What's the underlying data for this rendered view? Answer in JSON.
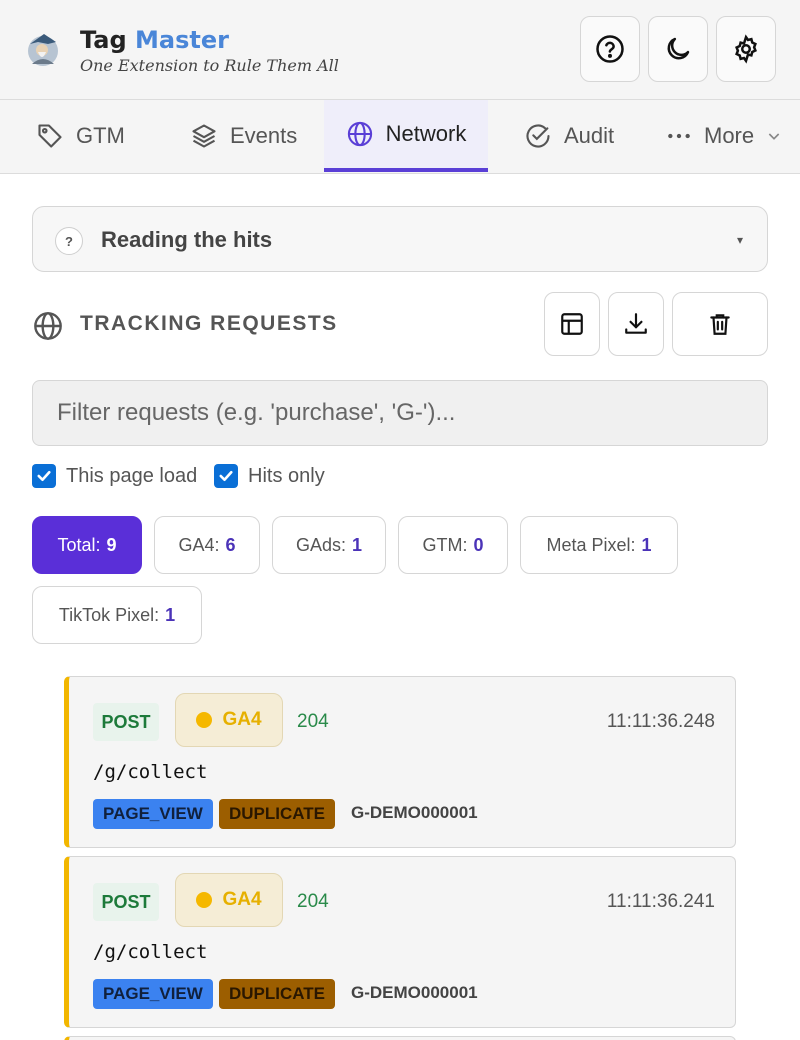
{
  "header": {
    "title_part1": "Tag",
    "title_part2": "Master",
    "subtitle": "One Extension to Rule Them All",
    "buttons": [
      "help-icon",
      "moon-icon",
      "gear-icon"
    ]
  },
  "tabs": [
    {
      "label": "GTM",
      "icon": "tag-icon"
    },
    {
      "label": "Events",
      "icon": "layers-icon"
    },
    {
      "label": "Network",
      "icon": "globe-icon",
      "active": true
    },
    {
      "label": "Audit",
      "icon": "check-circle-icon"
    },
    {
      "label": "More",
      "icon": "more-icon"
    }
  ],
  "reading": {
    "icon_text": "?",
    "label": "Reading the hits",
    "caret": "▾"
  },
  "section": {
    "title": "TRACKING REQUESTS"
  },
  "filter": {
    "placeholder": "Filter requests (e.g. 'purchase', 'G-')..."
  },
  "checkboxes": [
    {
      "label": "This page load",
      "checked": true
    },
    {
      "label": "Hits only",
      "checked": true
    }
  ],
  "chips": [
    {
      "label": "Total:",
      "count": "9",
      "active": true
    },
    {
      "label": "GA4:",
      "count": "6"
    },
    {
      "label": "GAds:",
      "count": "1"
    },
    {
      "label": "GTM:",
      "count": "0"
    },
    {
      "label": "Meta Pixel:",
      "count": "1"
    },
    {
      "label": "TikTok Pixel:",
      "count": "1"
    }
  ],
  "requests": [
    {
      "method": "POST",
      "vendor": "GA4",
      "status": "204",
      "time": "11:11:36.248",
      "path": "/g/collect",
      "event": "PAGE_VIEW",
      "flag": "DUPLICATE",
      "measurement_id": "G-DEMO000001"
    },
    {
      "method": "POST",
      "vendor": "GA4",
      "status": "204",
      "time": "11:11:36.241",
      "path": "/g/collect",
      "event": "PAGE_VIEW",
      "flag": "DUPLICATE",
      "measurement_id": "G-DEMO000001"
    }
  ],
  "colors": {
    "accent": "#5a2fd8",
    "ga4": "#f5b800",
    "post_text": "#1d7a3a",
    "page_view_tag": "#3b82f0",
    "duplicate_tag": "#9c5e00"
  }
}
